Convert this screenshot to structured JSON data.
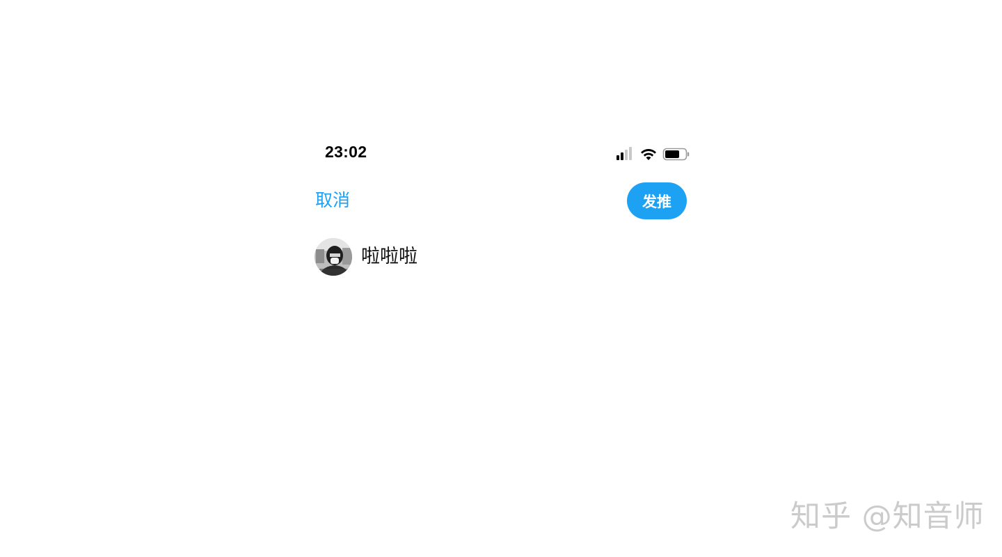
{
  "status_bar": {
    "time": "23:02",
    "icons": [
      "cellular-signal-icon",
      "wifi-icon",
      "battery-icon"
    ]
  },
  "compose_header": {
    "cancel_label": "取消",
    "tweet_label": "发推"
  },
  "compose_body": {
    "user_name": "啦啦啦",
    "avatar_icon": "user-avatar"
  },
  "watermark": {
    "text": "知乎 @知音师"
  },
  "colors": {
    "accent": "#1da1f2",
    "text": "#111111",
    "background": "#ffffff"
  }
}
